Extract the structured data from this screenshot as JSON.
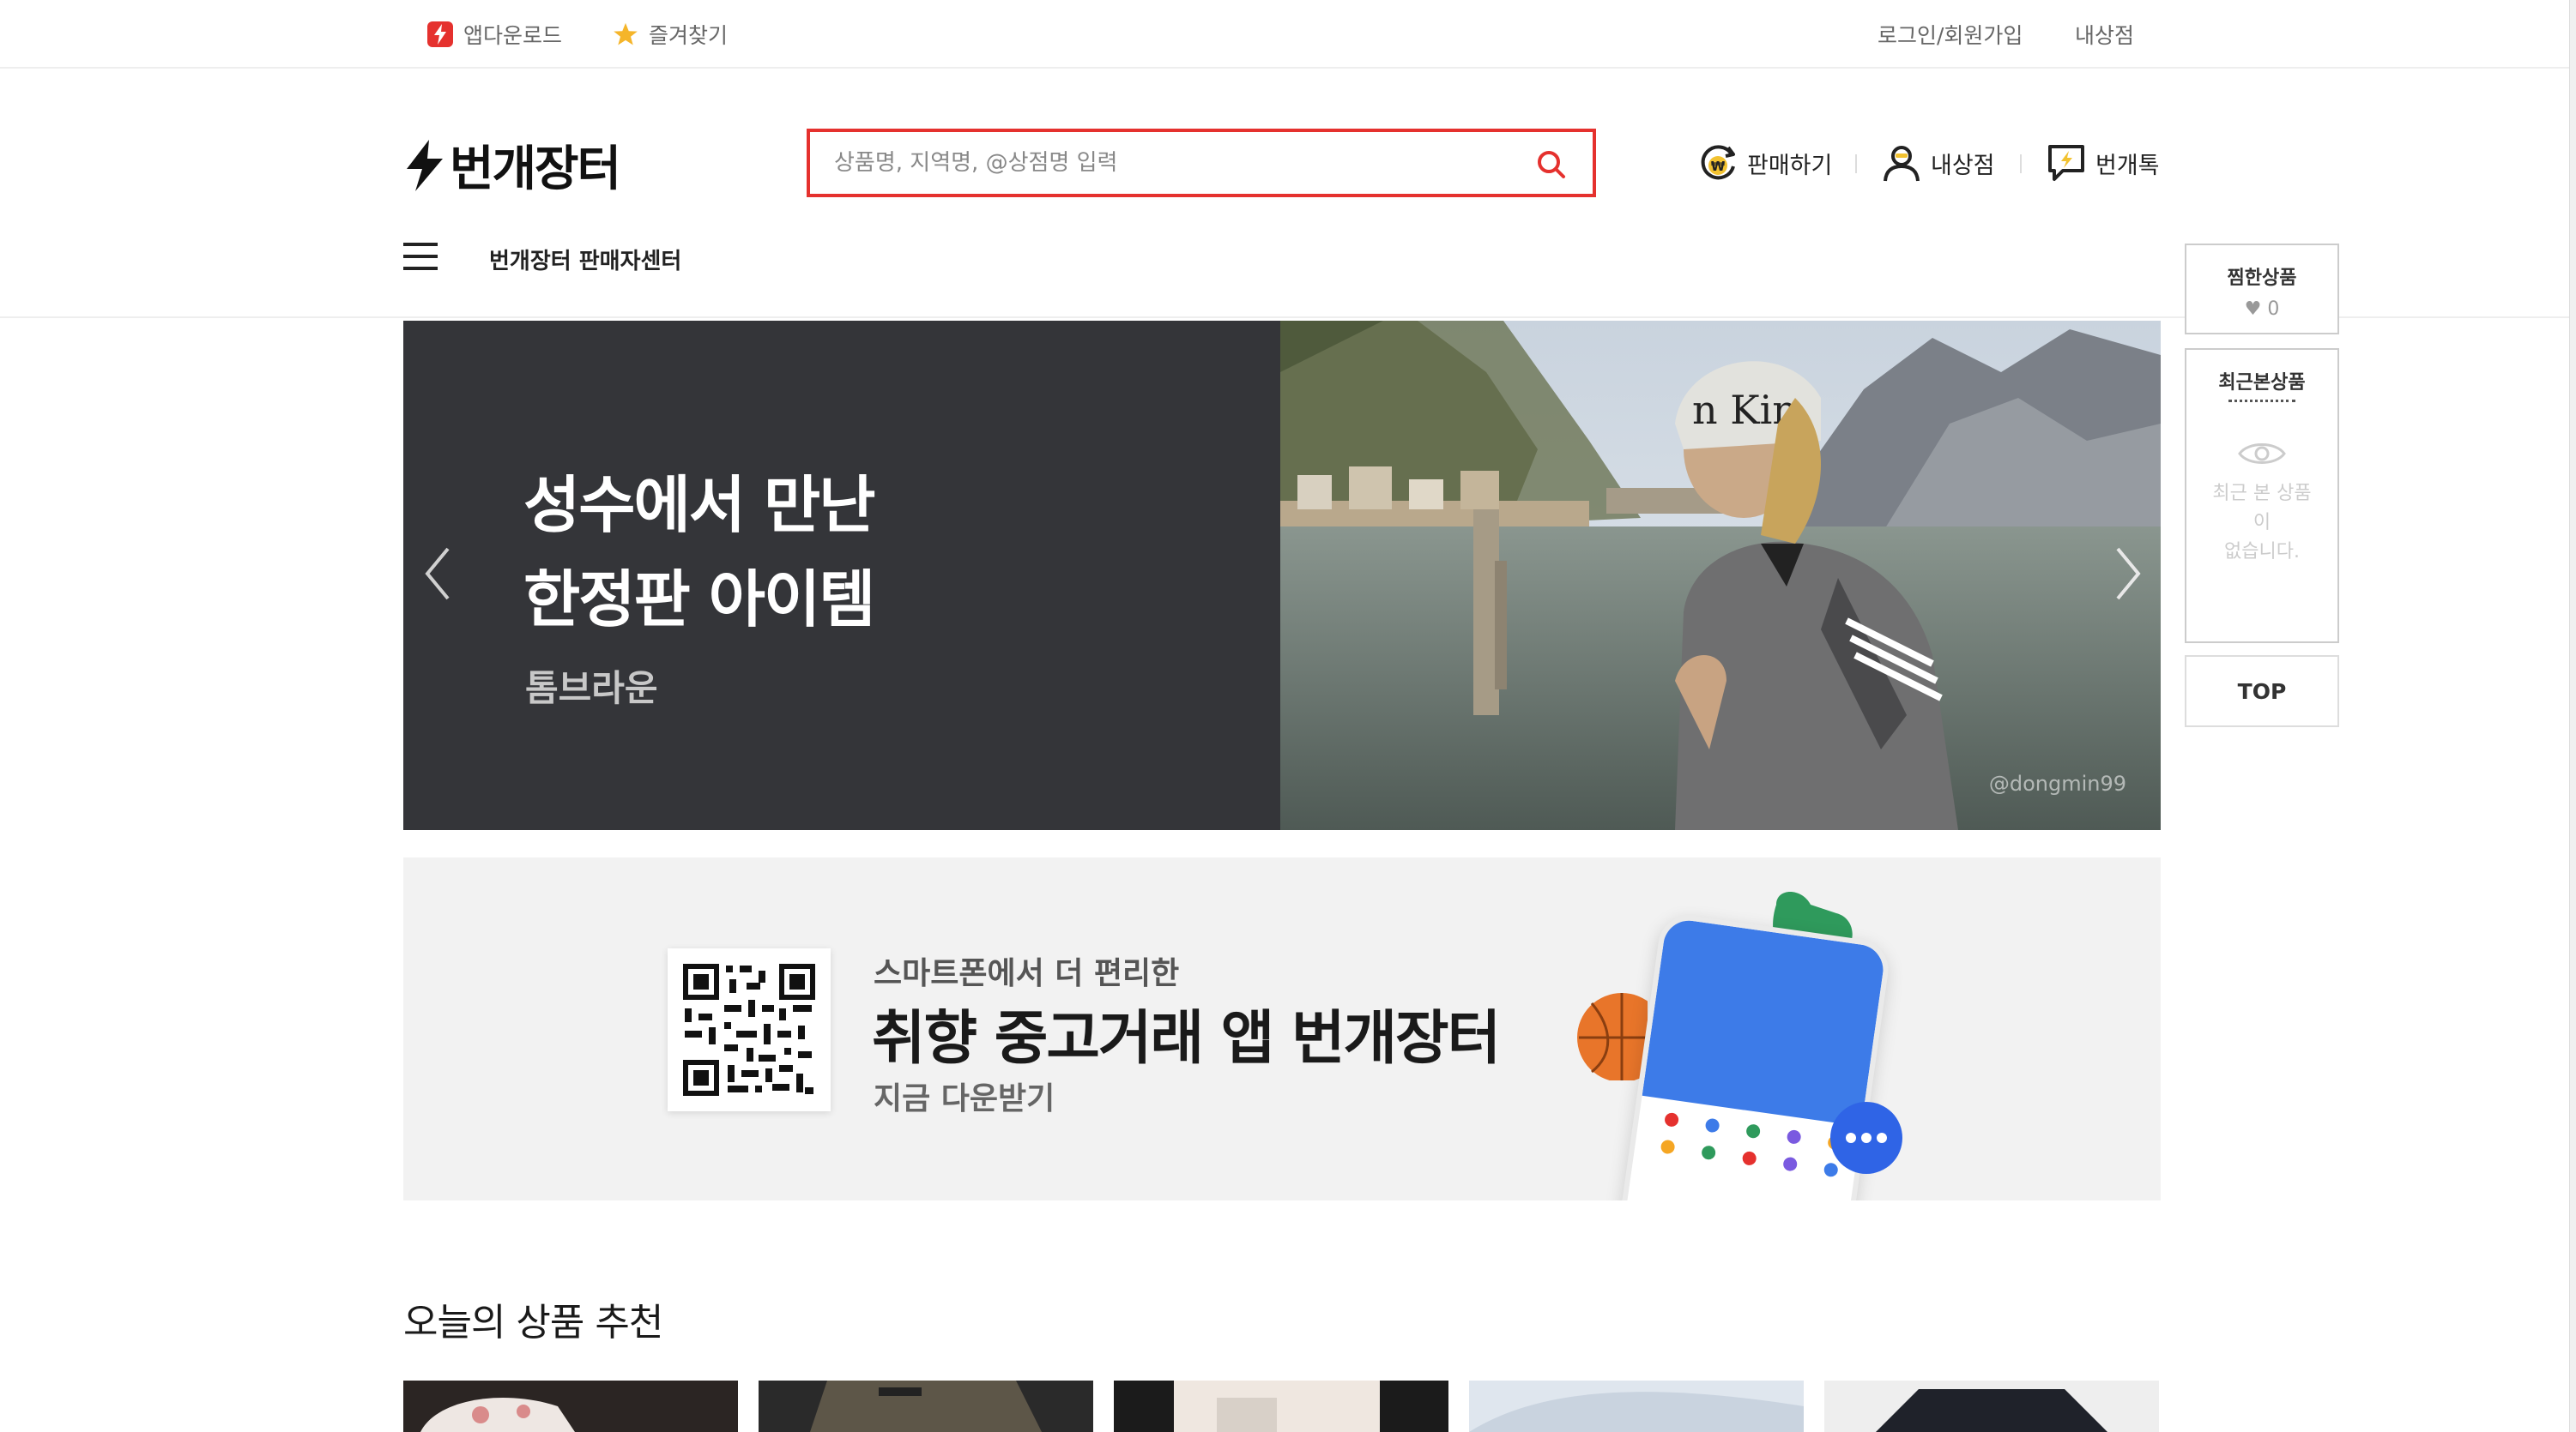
{
  "topbar": {
    "app_download": "앱다운로드",
    "favorites": "즐겨찾기",
    "login": "로그인/회원가입",
    "my_shop": "내상점"
  },
  "header": {
    "logo": "번개장터",
    "search_placeholder": "상품명, 지역명, @상점명 입력",
    "sell": "판매하기",
    "my_shop": "내상점",
    "talk": "번개톡",
    "seller_center": "번개장터 판매자센터"
  },
  "hero": {
    "title_line1": "성수에서 만난",
    "title_line2": "한정판 아이템",
    "subtitle": "톰브라운",
    "photo_credit": "@dongmin99"
  },
  "promo": {
    "line1": "스마트폰에서 더 편리한",
    "line2": "취향 중고거래 앱 번개장터",
    "line3": "지금 다운받기"
  },
  "recommend": {
    "title": "오늘의 상품 추천"
  },
  "sidebar": {
    "wishlist_label": "찜한상품",
    "wishlist_count": "♥ 0",
    "recent_label": "최근본상품",
    "recent_empty_line1": "최근 본 상품",
    "recent_empty_line2": "이",
    "recent_empty_line3": "없습니다.",
    "top_label": "TOP"
  },
  "colors": {
    "brand_red": "#e5312e",
    "hero_dark": "#343539",
    "promo_bg": "#f2f2f2"
  }
}
